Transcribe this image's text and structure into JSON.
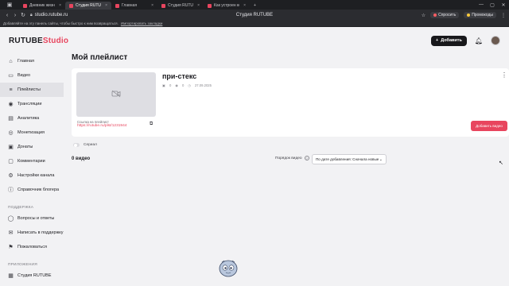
{
  "browser": {
    "tabs": [
      {
        "label": "Дневник жизни Богдан…",
        "active": false,
        "fav": "rutube"
      },
      {
        "label": "Студия RUTUBE",
        "active": true,
        "fav": "rutube"
      },
      {
        "label": "Главная",
        "active": false,
        "fav": "rutube"
      },
      {
        "label": "Студия RUTUBE",
        "active": false,
        "fav": "rutube"
      },
      {
        "label": "Как устроен компьютер",
        "active": false,
        "fav": "rutube"
      }
    ],
    "url": "studio.rutube.ru",
    "window_title": "Студия RUTUBE",
    "chip_ask": "Спросить",
    "chip_promo": "Промокоды",
    "bookmarks_text": "Добавляйте на эту панель сайты, чтобы быстро к ним возвращаться.",
    "bookmarks_link": "Импортировать закладки"
  },
  "header": {
    "logo_main": "RUTUBE",
    "logo_studio": "Studio",
    "add_label": "Добавить"
  },
  "sidebar": {
    "items": [
      {
        "label": "Главная",
        "icon": "home-icon",
        "glyph": "⌂",
        "active": false
      },
      {
        "label": "Видео",
        "icon": "video-icon",
        "glyph": "▭",
        "active": false
      },
      {
        "label": "Плейлисты",
        "icon": "playlist-icon",
        "glyph": "≡",
        "active": true
      },
      {
        "label": "Трансляции",
        "icon": "broadcast-icon",
        "glyph": "◉",
        "active": false
      },
      {
        "label": "Аналитика",
        "icon": "analytics-icon",
        "glyph": "▤",
        "active": false
      },
      {
        "label": "Монетизация",
        "icon": "monetization-icon",
        "glyph": "◎",
        "active": false
      },
      {
        "label": "Донаты",
        "icon": "donate-icon",
        "glyph": "▣",
        "active": false
      },
      {
        "label": "Комментарии",
        "icon": "comments-icon",
        "glyph": "▢",
        "active": false
      },
      {
        "label": "Настройки канала",
        "icon": "settings-icon",
        "glyph": "⚙",
        "active": false
      },
      {
        "label": "Справочник блогера",
        "icon": "info-icon",
        "glyph": "ⓘ",
        "active": false
      }
    ],
    "support_title": "ПОДДЕРЖКА",
    "support_items": [
      {
        "label": "Вопросы и ответы",
        "icon": "faq-icon",
        "glyph": "◯"
      },
      {
        "label": "Написать в поддержку",
        "icon": "mail-icon",
        "glyph": "✉"
      },
      {
        "label": "Пожаловаться",
        "icon": "flag-icon",
        "glyph": "⚑"
      }
    ],
    "apps_title": "ПРИЛОЖЕНИЯ",
    "apps_items": [
      {
        "label": "Студия RUTUBE",
        "icon": "app-icon",
        "glyph": "▦"
      }
    ]
  },
  "main": {
    "title": "Мой плейлист",
    "playlist": {
      "name": "при-стекс",
      "videos": "0",
      "views": "0",
      "date": "27.09.2025",
      "link_label": "Ссылка на плейлист",
      "link_url": "https://rutube.ru/plst/1231944"
    },
    "add_video_label": "Добавить видео",
    "serial_label": "Сериал",
    "count_label": "0 видео",
    "order_label": "Порядок видео",
    "order_value": "По дате добавления: Сначала новые"
  },
  "colors": {
    "accent": "#e8455e",
    "dark": "#18181b",
    "bg": "#f2f2f4"
  }
}
